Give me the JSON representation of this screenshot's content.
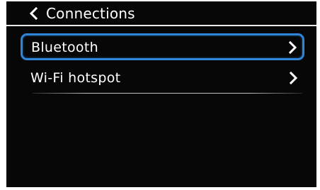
{
  "header": {
    "title": "Connections",
    "back_icon": "chevron-left-icon"
  },
  "menu": {
    "items": [
      {
        "label": "Bluetooth",
        "icon": "chevron-right-icon",
        "selected": true
      },
      {
        "label": "Wi-Fi hotspot",
        "icon": "chevron-right-icon",
        "selected": false
      }
    ]
  },
  "colors": {
    "background": "#070707",
    "text": "#ffffff",
    "focus_ring": "#2f86d8",
    "divider": "#e9e9e9"
  }
}
